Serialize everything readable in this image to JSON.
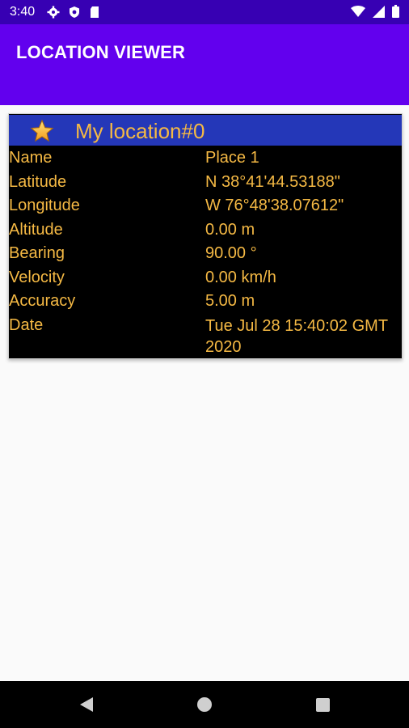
{
  "status_bar": {
    "time": "3:40",
    "icons_left": [
      "settings-icon",
      "shield-icon",
      "sd-card-icon"
    ],
    "icons_right": [
      "wifi-icon",
      "signal-icon",
      "battery-icon"
    ]
  },
  "app_bar": {
    "title": "LOCATION VIEWER",
    "color": "#6200ee",
    "status_color": "#3700b3"
  },
  "location_card": {
    "icon": "star-icon",
    "title": "My location#0",
    "header_color": "#2437b8",
    "text_color": "#f5b944",
    "fields": [
      {
        "label": "Name",
        "value": "Place 1"
      },
      {
        "label": "Latitude",
        "value": "N 38°41'44.53188\""
      },
      {
        "label": "Longitude",
        "value": "W 76°48'38.07612\""
      },
      {
        "label": "Altitude",
        "value": "0.00 m"
      },
      {
        "label": "Bearing",
        "value": "90.00 °"
      },
      {
        "label": "Velocity",
        "value": "0.00 km/h"
      },
      {
        "label": "Accuracy",
        "value": "5.00 m"
      },
      {
        "label": "Date",
        "value": "Tue Jul 28 15:40:02 GMT 2020"
      }
    ]
  },
  "nav_bar": {
    "icons": [
      "back-icon",
      "home-icon",
      "recents-icon"
    ]
  }
}
